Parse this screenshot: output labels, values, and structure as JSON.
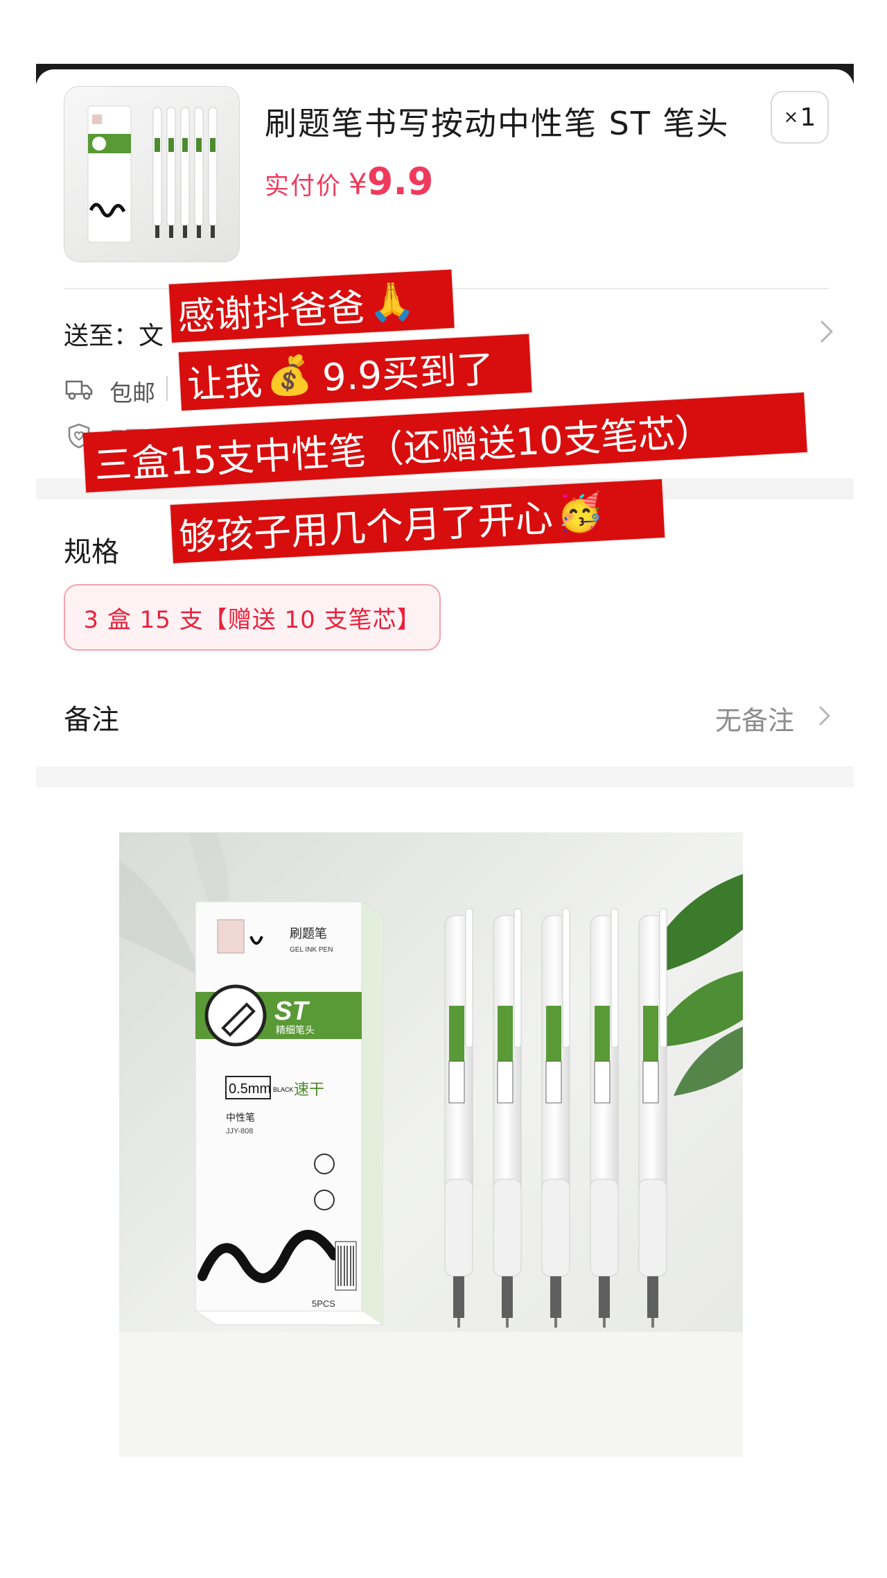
{
  "product": {
    "title": "刷题笔书写按动中性笔 ST 笔头",
    "price_label": "实付价",
    "currency": "¥",
    "price": "9.9",
    "quantity": "1",
    "quantity_prefix": "×"
  },
  "shipping": {
    "ship_to_label": "送至：文",
    "free_shipping": "包邮",
    "return_policy": "7天无理由退货"
  },
  "spec": {
    "title": "规格",
    "selected": "3 盒 15 支【赠送 10 支笔芯】"
  },
  "remark": {
    "label": "备注",
    "value": "无备注"
  },
  "overlay": {
    "line1": "感谢抖爸爸",
    "line1_emoji": "🙏",
    "line2_prefix": "让我",
    "line2_emoji": "💰",
    "line2_suffix": "9.9买到了",
    "line3": "三盒15支中性笔（还赠送10支笔芯）",
    "line4": "够孩子用几个月了开心",
    "line4_emoji": "🥳"
  },
  "package_print": {
    "brand": "刷题笔",
    "brand_en": "GEL INK PEN",
    "st": "ST",
    "tip": "精细笔头",
    "size": "0.5mm",
    "color": "BLACK",
    "quick_dry": "速干",
    "type": "中性笔",
    "model": "JJY-808",
    "count": "5PCS"
  },
  "colors": {
    "price_red": "#f03a5d",
    "strip_red": "#d80d0d",
    "chip_border": "#f3a2ae",
    "chip_bg": "#fff2f4",
    "box_green": "#5a9a36"
  },
  "icons": {
    "ship_arrow": "chevron-right-icon",
    "remark_arrow": "chevron-right-icon",
    "free_shipping": "truck-icon",
    "return_policy": "shield-heart-icon"
  }
}
